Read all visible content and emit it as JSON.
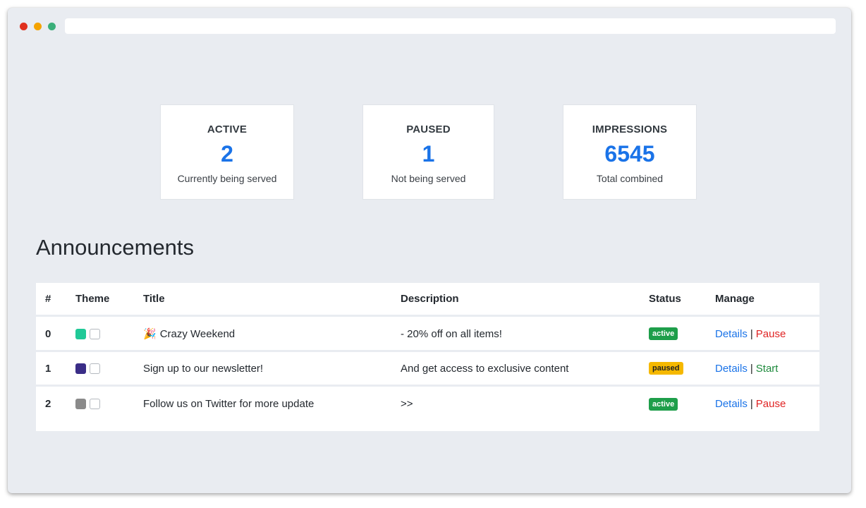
{
  "stats": [
    {
      "label": "ACTIVE",
      "value": "2",
      "sub": "Currently being served"
    },
    {
      "label": "PAUSED",
      "value": "1",
      "sub": "Not being served"
    },
    {
      "label": "IMPRESSIONS",
      "value": "6545",
      "sub": "Total combined"
    }
  ],
  "section_title": "Announcements",
  "table": {
    "headers": [
      "#",
      "Theme",
      "Title",
      "Description",
      "Status",
      "Manage"
    ],
    "rows": [
      {
        "num": "0",
        "theme_color": "#20c997",
        "emoji": "🎉",
        "title": "Crazy Weekend",
        "description": "- 20% off on all items!",
        "status": "active",
        "details": "Details",
        "sep": "|",
        "action": "Pause"
      },
      {
        "num": "1",
        "theme_color": "#3a2d87",
        "emoji": "",
        "title": "Sign up to our newsletter!",
        "description": "And get access to exclusive content",
        "status": "paused",
        "details": "Details",
        "sep": "|",
        "action": "Start"
      },
      {
        "num": "2",
        "theme_color": "#8a8a8a",
        "emoji": "",
        "title": "Follow us on Twitter for more update",
        "description": ">>",
        "status": "active",
        "details": "Details",
        "sep": "|",
        "action": "Pause"
      }
    ]
  },
  "colors": {
    "accent": "#1a73e8",
    "active_badge": "#1e9e4a",
    "paused_badge": "#f5b800",
    "pause_link": "#e02424",
    "start_link": "#1e8a3c"
  }
}
